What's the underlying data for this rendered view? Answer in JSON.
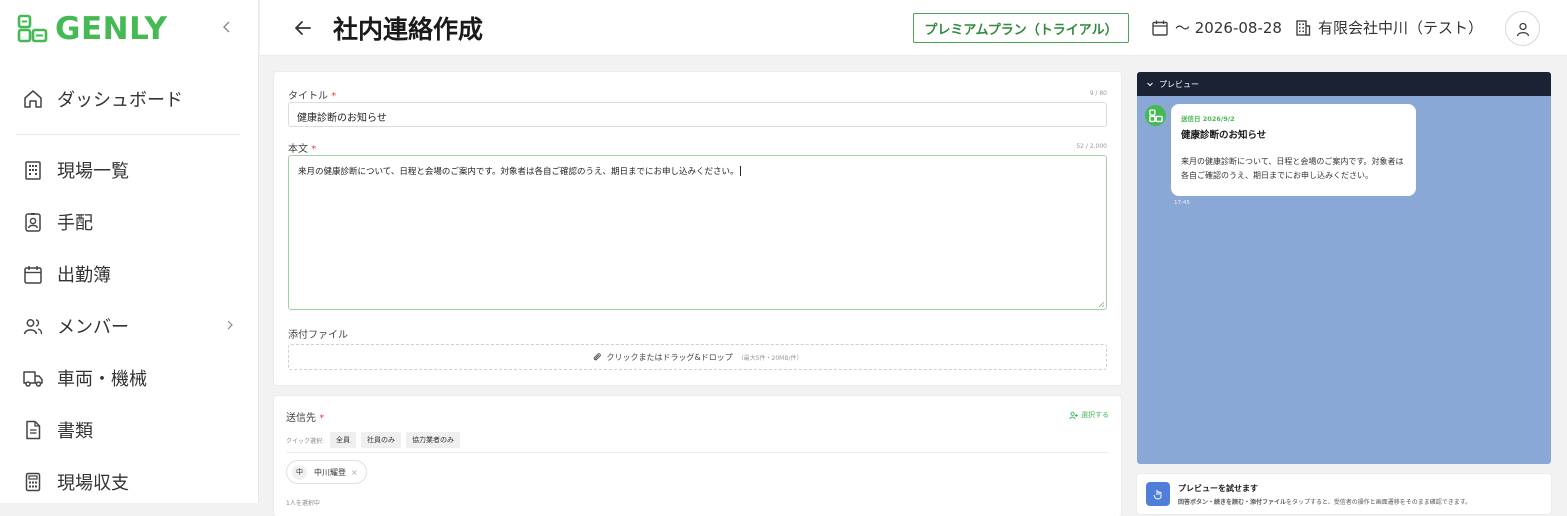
{
  "app": {
    "logo_text": "GENLY",
    "brand_color": "#45b954",
    "preview_bg": "#8aa8d6"
  },
  "sidebar": {
    "items": [
      {
        "label": "ダッシュボード",
        "icon": "home-icon"
      },
      {
        "label": "現場一覧",
        "icon": "building-icon"
      },
      {
        "label": "手配",
        "icon": "id-badge-icon"
      },
      {
        "label": "出勤簿",
        "icon": "calendar-icon"
      },
      {
        "label": "メンバー",
        "icon": "users-icon"
      },
      {
        "label": "車両・機械",
        "icon": "truck-icon"
      },
      {
        "label": "書類",
        "icon": "document-icon"
      },
      {
        "label": "現場収支",
        "icon": "calculator-icon"
      }
    ]
  },
  "header": {
    "title": "社内連絡作成",
    "plan_badge": "プレミアムプラン（トライアル）",
    "date_range": "〜 2026-08-28",
    "company": "有限会社中川（テスト）"
  },
  "form": {
    "title_label": "タイトル",
    "required_mark": "*",
    "title_counter": "9 / 80",
    "title_value": "健康診断のお知らせ",
    "body_label": "本文",
    "body_counter": "52 / 2,000",
    "body_value": "来月の健康診断について、日程と会場のご案内です。対象者は各自ご確認のうえ、期日までにお申し込みください。",
    "attachment_label": "添付ファイル",
    "attachment_prompt": "クリックまたはドラッグ&ドロップ",
    "attachment_hint": "（最大5件・20MB/件）"
  },
  "recipients": {
    "label": "送信先",
    "select_link": "選択する",
    "quick_label": "クイック選択:",
    "quick_options": [
      "全員",
      "社員のみ",
      "協力業者のみ"
    ],
    "selected": [
      {
        "initial": "中",
        "name": "中川耀登",
        "remove": "×"
      }
    ],
    "footer_partial": "1人を選択中"
  },
  "preview": {
    "header_label": "プレビュー",
    "send_date": "送信日 2026/9/2",
    "message_title": "健康診断のお知らせ",
    "message_body": "来月の健康診断について、日程と会場のご案内です。対象者は各自ご確認のうえ、期日までにお申し込みください。",
    "time": "17:45"
  },
  "try_preview": {
    "title": "プレビューを試せます",
    "desc_bold": "回答ボタン・続きを読む・添付ファイル",
    "desc_rest": "をタップすると、受信者の操作と画面遷移をそのまま確認できます。"
  }
}
